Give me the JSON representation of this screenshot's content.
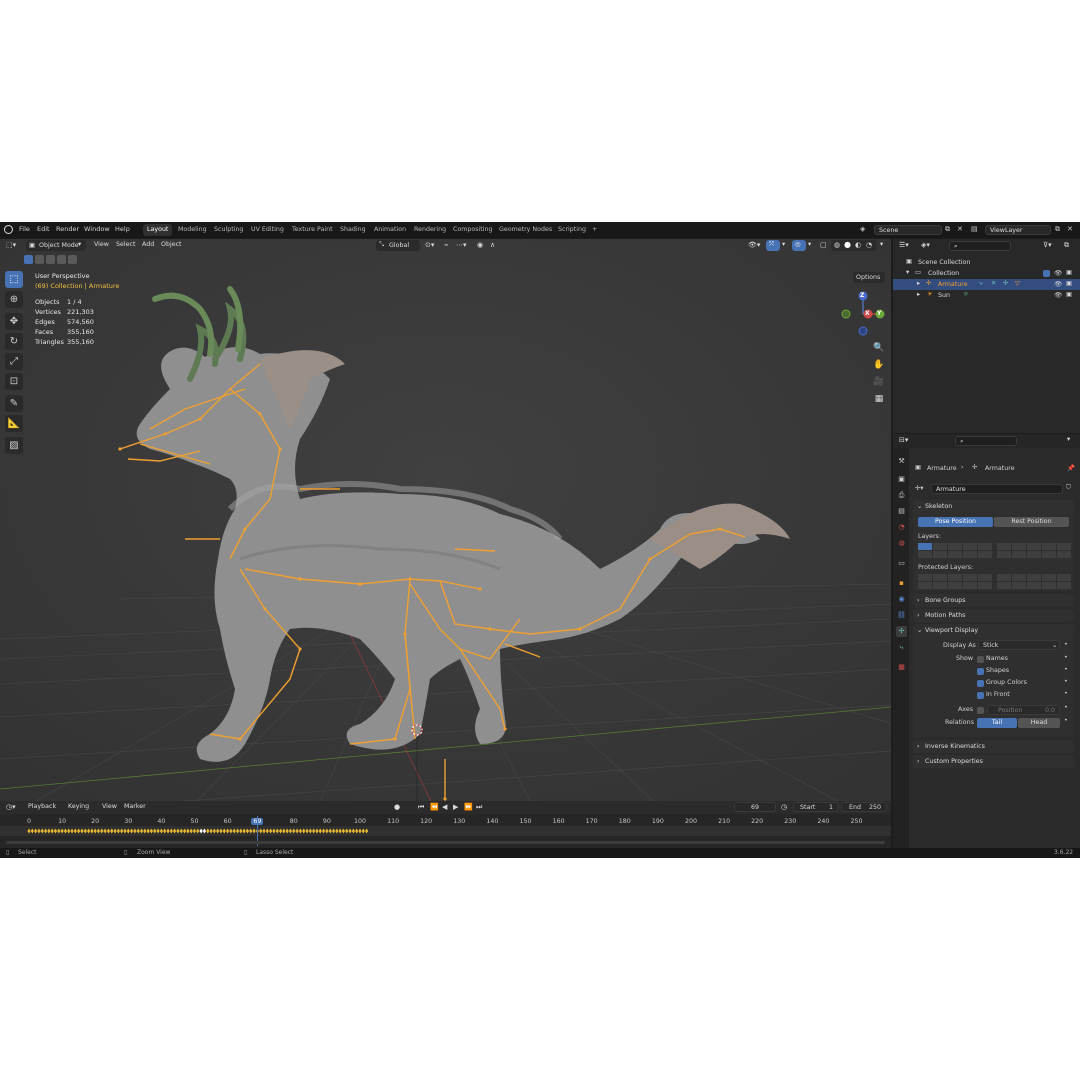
{
  "menu": [
    "File",
    "Edit",
    "Render",
    "Window",
    "Help"
  ],
  "workspace_tabs": [
    {
      "label": "Layout",
      "active": true
    },
    {
      "label": "Modeling",
      "active": false
    },
    {
      "label": "Sculpting",
      "active": false
    },
    {
      "label": "UV Editing",
      "active": false
    },
    {
      "label": "Texture Paint",
      "active": false
    },
    {
      "label": "Shading",
      "active": false
    },
    {
      "label": "Animation",
      "active": false
    },
    {
      "label": "Rendering",
      "active": false
    },
    {
      "label": "Compositing",
      "active": false
    },
    {
      "label": "Geometry Nodes",
      "active": false
    },
    {
      "label": "Scripting",
      "active": false
    },
    {
      "label": "+",
      "active": false
    }
  ],
  "scene": {
    "name": "Scene"
  },
  "view_layer": {
    "name": "ViewLayer"
  },
  "viewport_header": {
    "mode": "Object Mode",
    "menus": [
      "View",
      "Select",
      "Add",
      "Object"
    ],
    "transform_orientation": "Global",
    "options": "Options"
  },
  "viewport_overlay": {
    "view_name": "User Perspective",
    "context": "(69) Collection | Armature",
    "stats": [
      {
        "key": "Objects",
        "value": "1 / 4"
      },
      {
        "key": "Vertices",
        "value": "221,303"
      },
      {
        "key": "Edges",
        "value": "574,560"
      },
      {
        "key": "Faces",
        "value": "355,160"
      },
      {
        "key": "Triangles",
        "value": "355,160"
      }
    ]
  },
  "gizmo": {
    "z": "Z",
    "x": "X",
    "y": "Y"
  },
  "timeline": {
    "menus": [
      "Playback",
      "Keying",
      "View",
      "Marker"
    ],
    "current_frame": "69",
    "start_label": "Start",
    "start": "1",
    "end_label": "End",
    "end": "250",
    "frame_ticks": [
      "0",
      "10",
      "20",
      "30",
      "40",
      "50",
      "60",
      "69",
      "80",
      "90",
      "100",
      "110",
      "120",
      "130",
      "140",
      "150",
      "160",
      "170",
      "180",
      "190",
      "200",
      "210",
      "220",
      "230",
      "240",
      "250"
    ]
  },
  "status": {
    "select": "Select",
    "zoom": "Zoom View",
    "lasso": "Lasso Select",
    "version": "3.6.22"
  },
  "outliner": {
    "scene_collection": "Scene Collection",
    "collection": "Collection",
    "armature": "Armature",
    "sun": "Sun"
  },
  "properties": {
    "breadcrumb_object": "Armature",
    "breadcrumb_data": "Armature",
    "datablock_name": "Armature",
    "skeleton_header": "Skeleton",
    "pose_position": "Pose Position",
    "rest_position": "Rest Position",
    "layers_label": "Layers:",
    "protected_layers_label": "Protected Layers:",
    "bone_groups": "Bone Groups",
    "motion_paths": "Motion Paths",
    "viewport_display": "Viewport Display",
    "display_as_label": "Display As",
    "display_as_value": "Stick",
    "show_label": "Show",
    "show_names": "Names",
    "show_shapes": "Shapes",
    "show_group_colors": "Group Colors",
    "show_in_front": "In Front",
    "axes_label": "Axes",
    "position_label": "Position",
    "position_value": "0.0",
    "relations_label": "Relations",
    "tail": "Tail",
    "head": "Head",
    "inverse_kinematics": "Inverse Kinematics",
    "custom_properties": "Custom Properties"
  },
  "colors": {
    "accent": "#4772b3",
    "bone": "#f0a030",
    "playhead": "#4772b3",
    "keyframe": "#e8b830"
  }
}
